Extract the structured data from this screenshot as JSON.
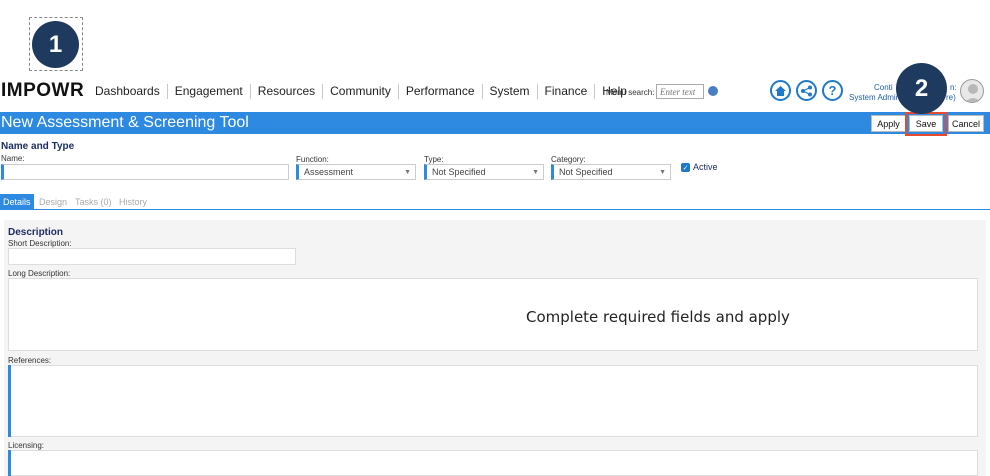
{
  "callouts": {
    "step1": "1",
    "step2": "2"
  },
  "brand": {
    "logo_text": "IMPOWR"
  },
  "nav": {
    "items": [
      "Dashboards",
      "Engagement",
      "Resources",
      "Community",
      "Performance",
      "System",
      "Finance",
      "Help"
    ],
    "menu_search_label": "Menu search:",
    "menu_search_placeholder": "Enter text"
  },
  "header_icons": [
    "home-icon",
    "share-icon",
    "help-icon"
  ],
  "user": {
    "line1": "Conti",
    "line2": "System Admin",
    "suffix1": "n:",
    "suffix2": "re)"
  },
  "page": {
    "title": "New Assessment & Screening Tool",
    "buttons": {
      "apply": "Apply",
      "save": "Save",
      "cancel": "Cancel"
    }
  },
  "name_type": {
    "section_title": "Name and Type",
    "name_label": "Name:",
    "name_value": "",
    "function_label": "Function:",
    "function_value": "Assessment",
    "type_label": "Type:",
    "type_value": "Not Specified",
    "category_label": "Category:",
    "category_value": "Not Specified",
    "active_label": "Active",
    "active_checked": true
  },
  "tabs": [
    "Details",
    "Design",
    "Tasks (0)",
    "History"
  ],
  "description": {
    "section_title": "Description",
    "short_label": "Short Description:",
    "long_label": "Long Description:",
    "references_label": "References:",
    "licensing_label": "Licensing:"
  },
  "overlay_message": "Complete required fields and apply",
  "colors": {
    "accent": "#2d8ae0",
    "callout": "#1f3a5f",
    "highlight": "#e84a2e"
  }
}
